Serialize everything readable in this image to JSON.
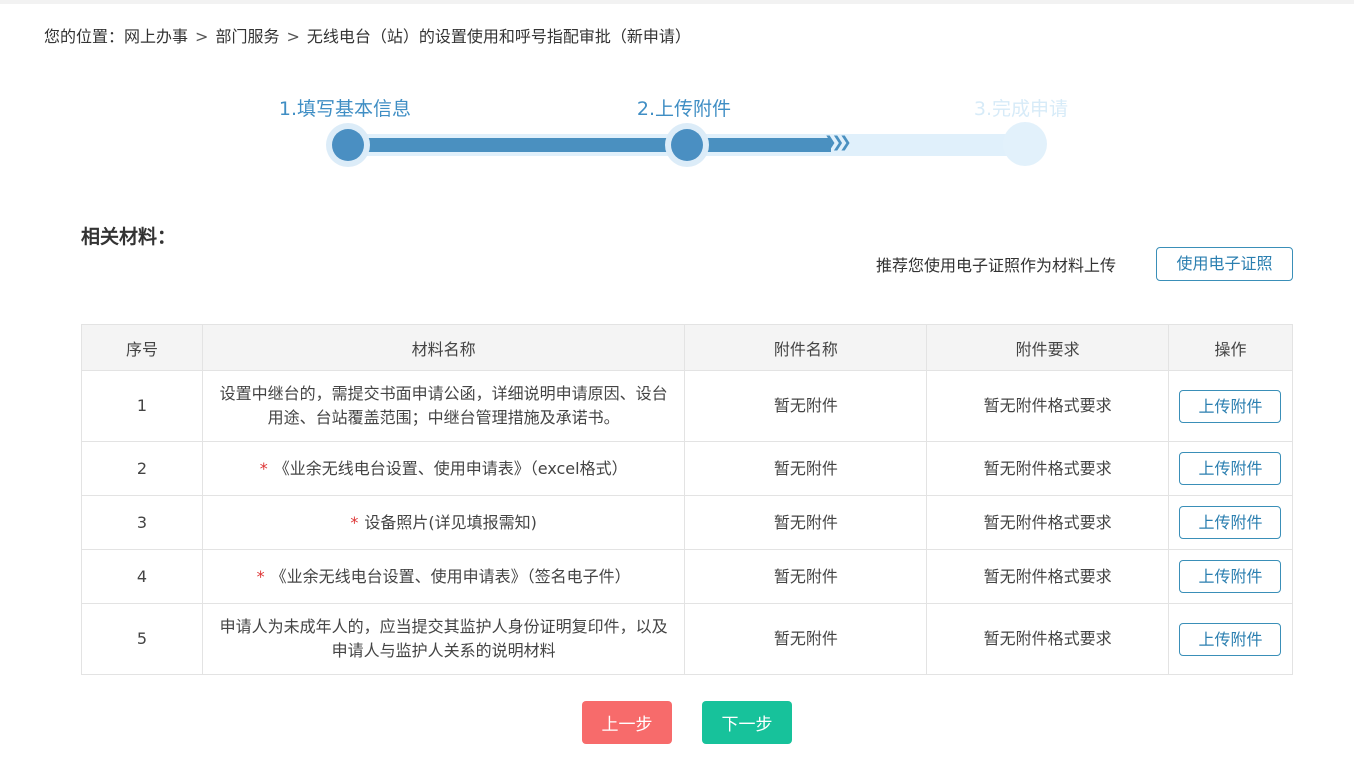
{
  "breadcrumb": {
    "prefix": "您的位置：",
    "items": [
      "网上办事",
      "部门服务",
      "无线电台（站）的设置使用和呼号指配审批（新申请）"
    ],
    "separator": ">"
  },
  "steps": [
    {
      "label": "1.填写基本信息",
      "state": "done"
    },
    {
      "label": "2.上传附件",
      "state": "current"
    },
    {
      "label": "3.完成申请",
      "state": "pending"
    }
  ],
  "materials": {
    "title": "相关材料：",
    "recommend_text": "推荐您使用电子证照作为材料上传",
    "ecert_button": "使用电子证照",
    "columns": [
      "序号",
      "材料名称",
      "附件名称",
      "附件要求",
      "操作"
    ],
    "rows": [
      {
        "index": "1",
        "required": "",
        "name": "设置中继台的，需提交书面申请公函，详细说明申请原因、设台用途、台站覆盖范围；中继台管理措施及承诺书。",
        "attachment": "暂无附件",
        "requirement": "暂无附件格式要求",
        "action": "上传附件"
      },
      {
        "index": "2",
        "required": "*",
        "name": "《业余无线电台设置、使用申请表》（excel格式）",
        "attachment": "暂无附件",
        "requirement": "暂无附件格式要求",
        "action": "上传附件"
      },
      {
        "index": "3",
        "required": "*",
        "name": "设备照片(详见填报需知)",
        "attachment": "暂无附件",
        "requirement": "暂无附件格式要求",
        "action": "上传附件"
      },
      {
        "index": "4",
        "required": "*",
        "name": "《业余无线电台设置、使用申请表》（签名电子件）",
        "attachment": "暂无附件",
        "requirement": "暂无附件格式要求",
        "action": "上传附件"
      },
      {
        "index": "5",
        "required": "",
        "name": "申请人为未成年人的，应当提交其监护人身份证明复印件，以及申请人与监护人关系的说明材料",
        "attachment": "暂无附件",
        "requirement": "暂无附件格式要求",
        "action": "上传附件"
      }
    ]
  },
  "footer": {
    "prev_label": "上一步",
    "next_label": "下一步"
  },
  "colors": {
    "accent_blue": "#4a90c0",
    "prev_button": "#f76b6b",
    "next_button": "#17c29b",
    "required_mark": "#dd3333"
  }
}
